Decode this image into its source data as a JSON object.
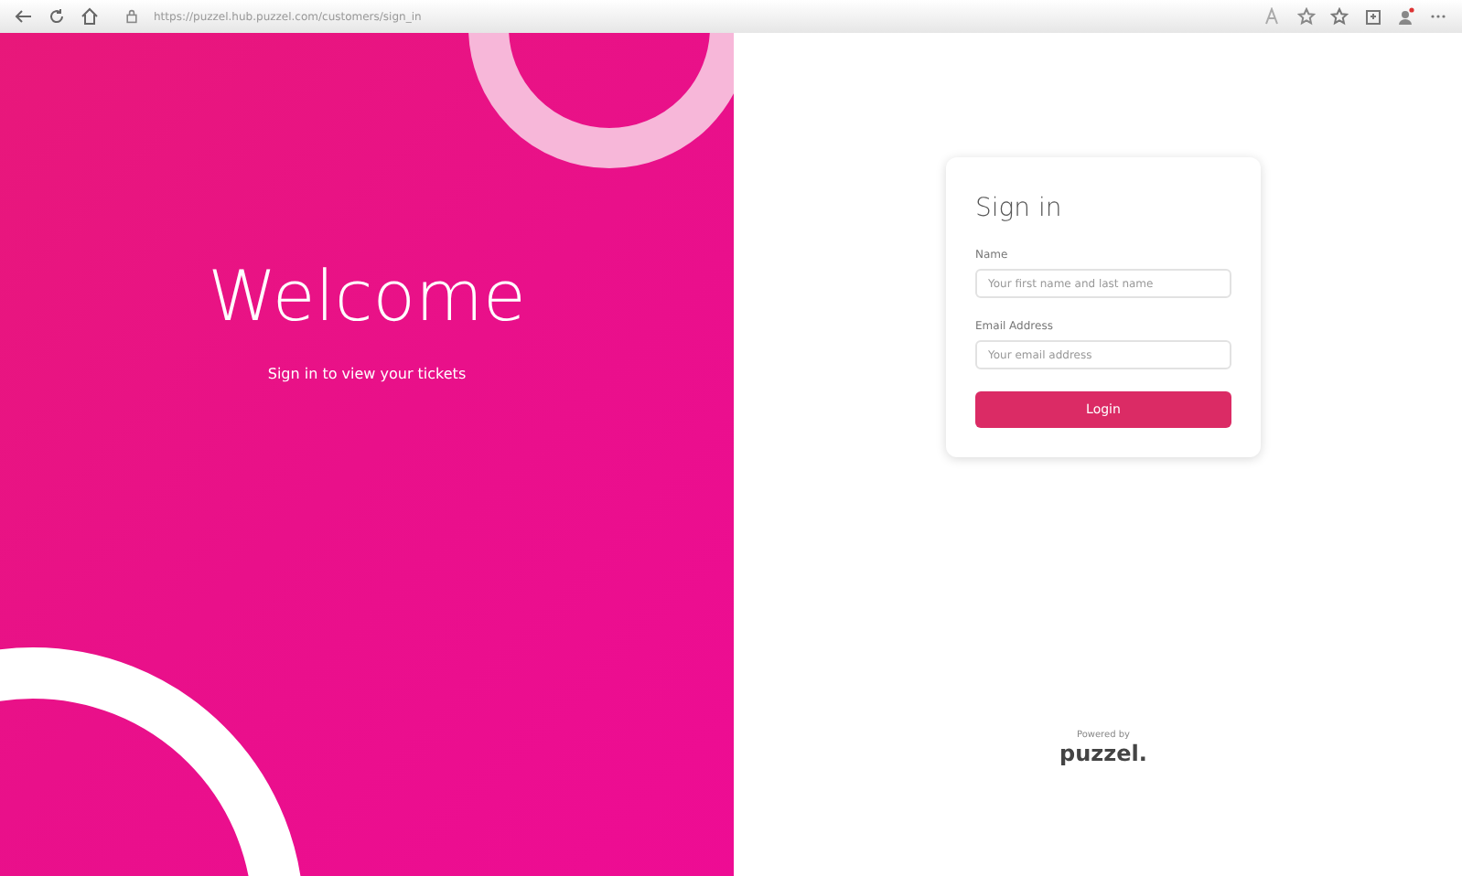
{
  "browser": {
    "url": "https://puzzel.hub.puzzel.com/customers/sign_in"
  },
  "hero": {
    "title": "Welcome",
    "subtitle": "Sign in to view your tickets"
  },
  "form": {
    "title": "Sign in",
    "fields": [
      {
        "label": "Name",
        "placeholder": "Your first name and last name"
      },
      {
        "label": "Email Address",
        "placeholder": "Your email address"
      }
    ],
    "button": "Login"
  },
  "footer": {
    "powered_by": "Powered by",
    "logo": "puzzel."
  }
}
